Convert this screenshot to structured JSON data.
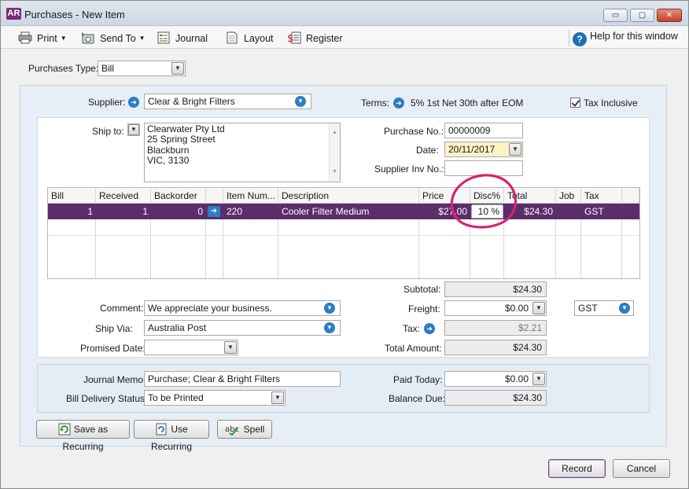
{
  "app": {
    "logo_text": "AR",
    "window_title": "Purchases - New Item",
    "controls": {
      "minimize": "▭",
      "maximize": "▢",
      "close": "✕"
    }
  },
  "toolbar": {
    "print": "Print",
    "send_to": "Send To",
    "journal": "Journal",
    "layout": "Layout",
    "register": "Register",
    "help": "Help for this window"
  },
  "purchase_type": {
    "label": "Purchases Type:",
    "value": "Bill"
  },
  "supplier": {
    "label": "Supplier:",
    "value": "Clear & Bright Filters"
  },
  "terms": {
    "label": "Terms:",
    "value": "5% 1st Net 30th after EOM"
  },
  "tax_inclusive": {
    "label": "Tax Inclusive",
    "checked": true
  },
  "ship_to": {
    "label": "Ship to:",
    "lines": [
      "Clearwater Pty Ltd",
      "25 Spring Street",
      "Blackburn",
      "VIC, 3130"
    ]
  },
  "purchase_no": {
    "label": "Purchase No.:",
    "value": "00000009"
  },
  "date": {
    "label": "Date:",
    "value": "20/11/2017"
  },
  "supplier_inv_no": {
    "label": "Supplier Inv No.:",
    "value": ""
  },
  "grid": {
    "headers": [
      "Bill",
      "Received",
      "Backorder",
      "",
      "Item Num...",
      "Description",
      "Price",
      "Disc%",
      "Total",
      "Job",
      "Tax"
    ],
    "rows": [
      {
        "bill": "1",
        "received": "1",
        "backorder": "0",
        "item": "220",
        "description": "Cooler Filter Medium",
        "price": "$27.00",
        "disc": "10 %",
        "total": "$24.30",
        "job": "",
        "tax": "GST"
      }
    ]
  },
  "totals": {
    "subtotal_label": "Subtotal:",
    "subtotal": "$24.30",
    "freight_label": "Freight:",
    "freight": "$0.00",
    "freight_tax": "GST",
    "tax_label": "Tax:",
    "tax": "$2.21",
    "total_label": "Total Amount:",
    "total": "$24.30"
  },
  "comment": {
    "label": "Comment:",
    "value": "We appreciate your business."
  },
  "ship_via": {
    "label": "Ship Via:",
    "value": "Australia Post"
  },
  "promised_date": {
    "label": "Promised Date:",
    "value": ""
  },
  "journal_memo": {
    "label": "Journal Memo:",
    "value": "Purchase; Clear & Bright Filters"
  },
  "bill_delivery": {
    "label": "Bill Delivery Status:",
    "value": "To be Printed"
  },
  "paid_today": {
    "label": "Paid Today:",
    "value": "$0.00"
  },
  "balance_due": {
    "label": "Balance Due:",
    "value": "$24.30"
  },
  "buttons": {
    "save_recurring": "Save as Recurring",
    "use_recurring": "Use Recurring",
    "spell": "Spell",
    "record": "Record",
    "cancel": "Cancel"
  },
  "colors": {
    "selection": "#5b2d6b",
    "annotation": "#d6246e",
    "accent_blue": "#2d7cc4"
  }
}
